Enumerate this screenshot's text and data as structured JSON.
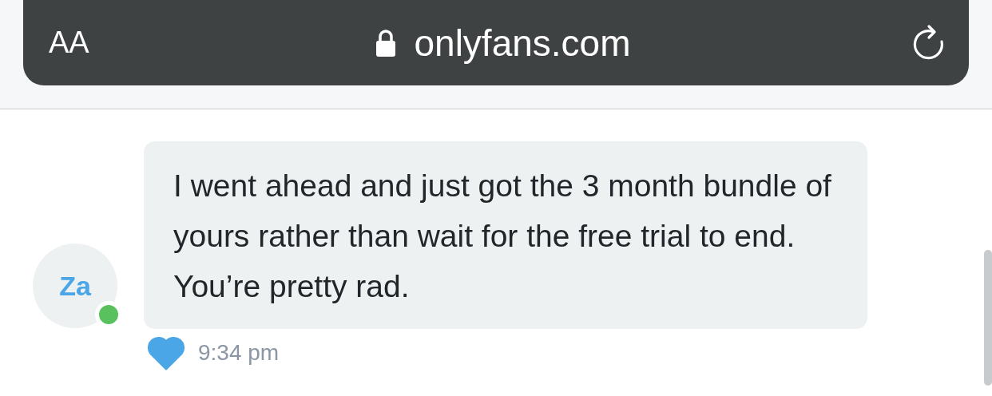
{
  "address_bar": {
    "text_size_label": "AA",
    "url": "onlyfans.com",
    "secure": true
  },
  "message": {
    "avatar_initials": "Za",
    "online": true,
    "text": "I went ahead and just got the 3 month bundle of yours rather than wait for the free trial to end. You’re pretty rad.",
    "liked": true,
    "time": "9:34 pm"
  }
}
